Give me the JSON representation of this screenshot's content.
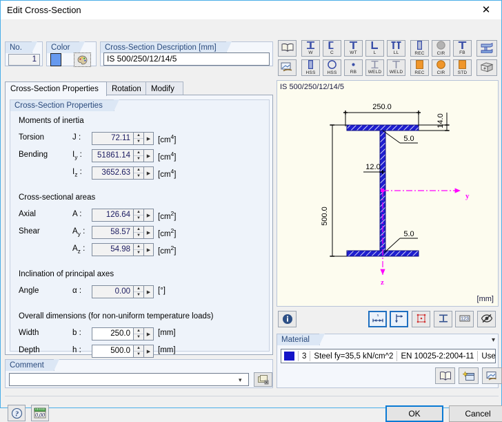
{
  "window": {
    "title": "Edit Cross-Section",
    "close_label": "✕"
  },
  "header": {
    "no_group_label": "No.",
    "no_value": "1",
    "color_group_label": "Color",
    "color_swatch_hex": "#6699ee",
    "color_button_icon": "palette-icon",
    "description_group_label": "Cross-Section Description [mm]",
    "description_value": "IS 500/250/12/14/5"
  },
  "tabs": [
    {
      "label": "Cross-Section Properties",
      "active": true
    },
    {
      "label": "Rotation",
      "active": false
    },
    {
      "label": "Modify",
      "active": false
    }
  ],
  "properties": {
    "panel_title": "Cross-Section Properties",
    "sections": [
      {
        "title": "Moments of inertia",
        "rows": [
          {
            "label": "Torsion",
            "symbol": "J",
            "sub": "",
            "value": "72.11",
            "unit": "cm",
            "exp": "4",
            "editable": false
          },
          {
            "label": "Bending",
            "symbol": "I",
            "sub": "y",
            "value": "51861.14",
            "unit": "cm",
            "exp": "4",
            "editable": false
          },
          {
            "label": "",
            "symbol": "I",
            "sub": "z",
            "value": "3652.63",
            "unit": "cm",
            "exp": "4",
            "editable": false
          }
        ]
      },
      {
        "title": "Cross-sectional areas",
        "rows": [
          {
            "label": "Axial",
            "symbol": "A",
            "sub": "",
            "value": "126.64",
            "unit": "cm",
            "exp": "2",
            "editable": false
          },
          {
            "label": "Shear",
            "symbol": "A",
            "sub": "y",
            "value": "58.57",
            "unit": "cm",
            "exp": "2",
            "editable": false
          },
          {
            "label": "",
            "symbol": "A",
            "sub": "z",
            "value": "54.98",
            "unit": "cm",
            "exp": "2",
            "editable": false
          }
        ]
      },
      {
        "title": "Inclination of principal axes",
        "rows": [
          {
            "label": "Angle",
            "symbol": "α",
            "sub": "",
            "value": "0.00",
            "unit": "°",
            "exp": "",
            "editable": false
          }
        ]
      },
      {
        "title": "Overall dimensions (for non-uniform temperature loads)",
        "rows": [
          {
            "label": "Width",
            "symbol": "b",
            "sub": "",
            "value": "250.0",
            "unit": "mm",
            "exp": "",
            "editable": true
          },
          {
            "label": "Depth",
            "symbol": "h",
            "sub": "",
            "value": "500.0",
            "unit": "mm",
            "exp": "",
            "editable": true
          }
        ]
      }
    ]
  },
  "comment": {
    "group_label": "Comment",
    "value": "",
    "placeholder": "",
    "dropdown_icon": "chevron-down-icon",
    "button_icon": "comment-library-icon"
  },
  "toolbar": {
    "row1": [
      {
        "name": "library-button",
        "caption": "",
        "icon": "book-icon"
      },
      {
        "name": "shape-w-button",
        "caption": "W",
        "icon": "i-section-icon"
      },
      {
        "name": "shape-c-button",
        "caption": "C",
        "icon": "channel-icon"
      },
      {
        "name": "shape-wt-button",
        "caption": "WT",
        "icon": "tee-icon"
      },
      {
        "name": "shape-l-button",
        "caption": "L",
        "icon": "angle-icon"
      },
      {
        "name": "shape-ll-button",
        "caption": "LL",
        "icon": "double-angle-icon"
      },
      {
        "name": "shape-rec-hollow-button",
        "caption": "REC",
        "icon": "rect-hollow-icon"
      },
      {
        "name": "shape-cir-hollow-button",
        "caption": "CIR",
        "icon": "circle-hollow-icon"
      },
      {
        "name": "shape-fb-button",
        "caption": "FB",
        "icon": "flatbar-icon"
      },
      {
        "name": "parametric-steel-button",
        "caption": "",
        "icon": "steel-beam-icon"
      }
    ],
    "row2": [
      {
        "name": "import-button",
        "caption": "",
        "icon": "import-icon"
      },
      {
        "name": "shape-hss-rect-button",
        "caption": "HSS",
        "icon": "hss-rect-icon"
      },
      {
        "name": "shape-hss-round-button",
        "caption": "HSS",
        "icon": "hss-round-icon"
      },
      {
        "name": "shape-rb-button",
        "caption": "RB",
        "icon": "round-bar-icon"
      },
      {
        "name": "shape-weld-i-button",
        "caption": "WELD",
        "icon": "welded-i-icon"
      },
      {
        "name": "shape-weld-t-button",
        "caption": "WELD",
        "icon": "welded-t-icon"
      },
      {
        "name": "shape-rec-solid-button",
        "caption": "REC",
        "icon": "rect-solid-icon"
      },
      {
        "name": "shape-cir-solid-button",
        "caption": "CIR",
        "icon": "circle-solid-icon"
      },
      {
        "name": "shape-std-button",
        "caption": "STD",
        "icon": "standard-solid-icon"
      },
      {
        "name": "general-section-button",
        "caption": "",
        "icon": "solid-block-icon"
      }
    ]
  },
  "drawing": {
    "title": "IS 500/250/12/14/5",
    "unit_label": "[mm]",
    "axis_y_label": "y",
    "axis_z_label": "z",
    "dimensions": {
      "width": "250.0",
      "depth": "500.0",
      "flange_thickness": "14.0",
      "web_thickness": "12.0",
      "weld_top": "5.0",
      "weld_bottom": "5.0"
    },
    "section_fill_hex": "#1f1fcf",
    "background_hex": "#fdfcef"
  },
  "view_toolbar": {
    "info_button": "info-icon",
    "buttons": [
      {
        "name": "show-dimensions-button",
        "icon": "dimension-x-icon",
        "selected": true
      },
      {
        "name": "show-axes-button",
        "icon": "axes-icon",
        "selected": true
      },
      {
        "name": "show-grid-points-button",
        "icon": "grid-points-icon",
        "selected": false
      },
      {
        "name": "show-section-outline-button",
        "icon": "section-outline-icon",
        "selected": false
      },
      {
        "name": "show-numbers-button",
        "icon": "numbers-123-icon",
        "selected": false
      },
      {
        "name": "hide-all-button",
        "icon": "hide-icon",
        "selected": false
      }
    ]
  },
  "material": {
    "group_label": "Material",
    "swatch_hex": "#1414c8",
    "number": "3",
    "name": "Steel fy=35,5 kN/cm^2",
    "standard": "EN 10025-2:2004-11",
    "extra": "Use",
    "dropdown_icon": "chevron-down-icon",
    "buttons": [
      {
        "name": "material-library-button",
        "icon": "book-icon"
      },
      {
        "name": "new-material-button",
        "icon": "new-material-icon"
      },
      {
        "name": "import-material-button",
        "icon": "import-icon"
      }
    ]
  },
  "footer": {
    "help_button": "help-icon",
    "units_button": "units-icon",
    "ok_label": "OK",
    "cancel_label": "Cancel"
  }
}
